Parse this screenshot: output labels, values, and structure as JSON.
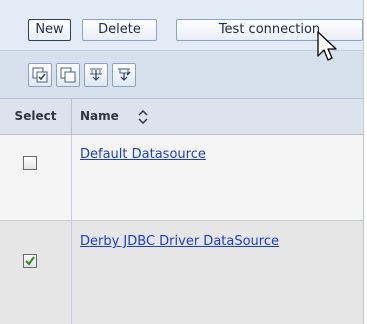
{
  "toolbar": {
    "new_label": "New",
    "delete_label": "Delete",
    "test_label": "Test connection"
  },
  "icon_tools": [
    {
      "icon": "select-all-icon"
    },
    {
      "icon": "deselect-all-icon"
    },
    {
      "icon": "expand-filter-icon"
    },
    {
      "icon": "edit-filter-icon"
    }
  ],
  "table": {
    "columns": [
      "Select",
      "Name"
    ],
    "sort_icon": "sort-toggle-icon",
    "rows": [
      {
        "name": "Default Datasource",
        "selected": false
      },
      {
        "name": "Derby JDBC Driver DataSource",
        "selected": true
      }
    ]
  },
  "colors": {
    "link": "#1c3fc4",
    "check": "#2e8b2e",
    "toolbar_bg": "#e3ebf7"
  }
}
